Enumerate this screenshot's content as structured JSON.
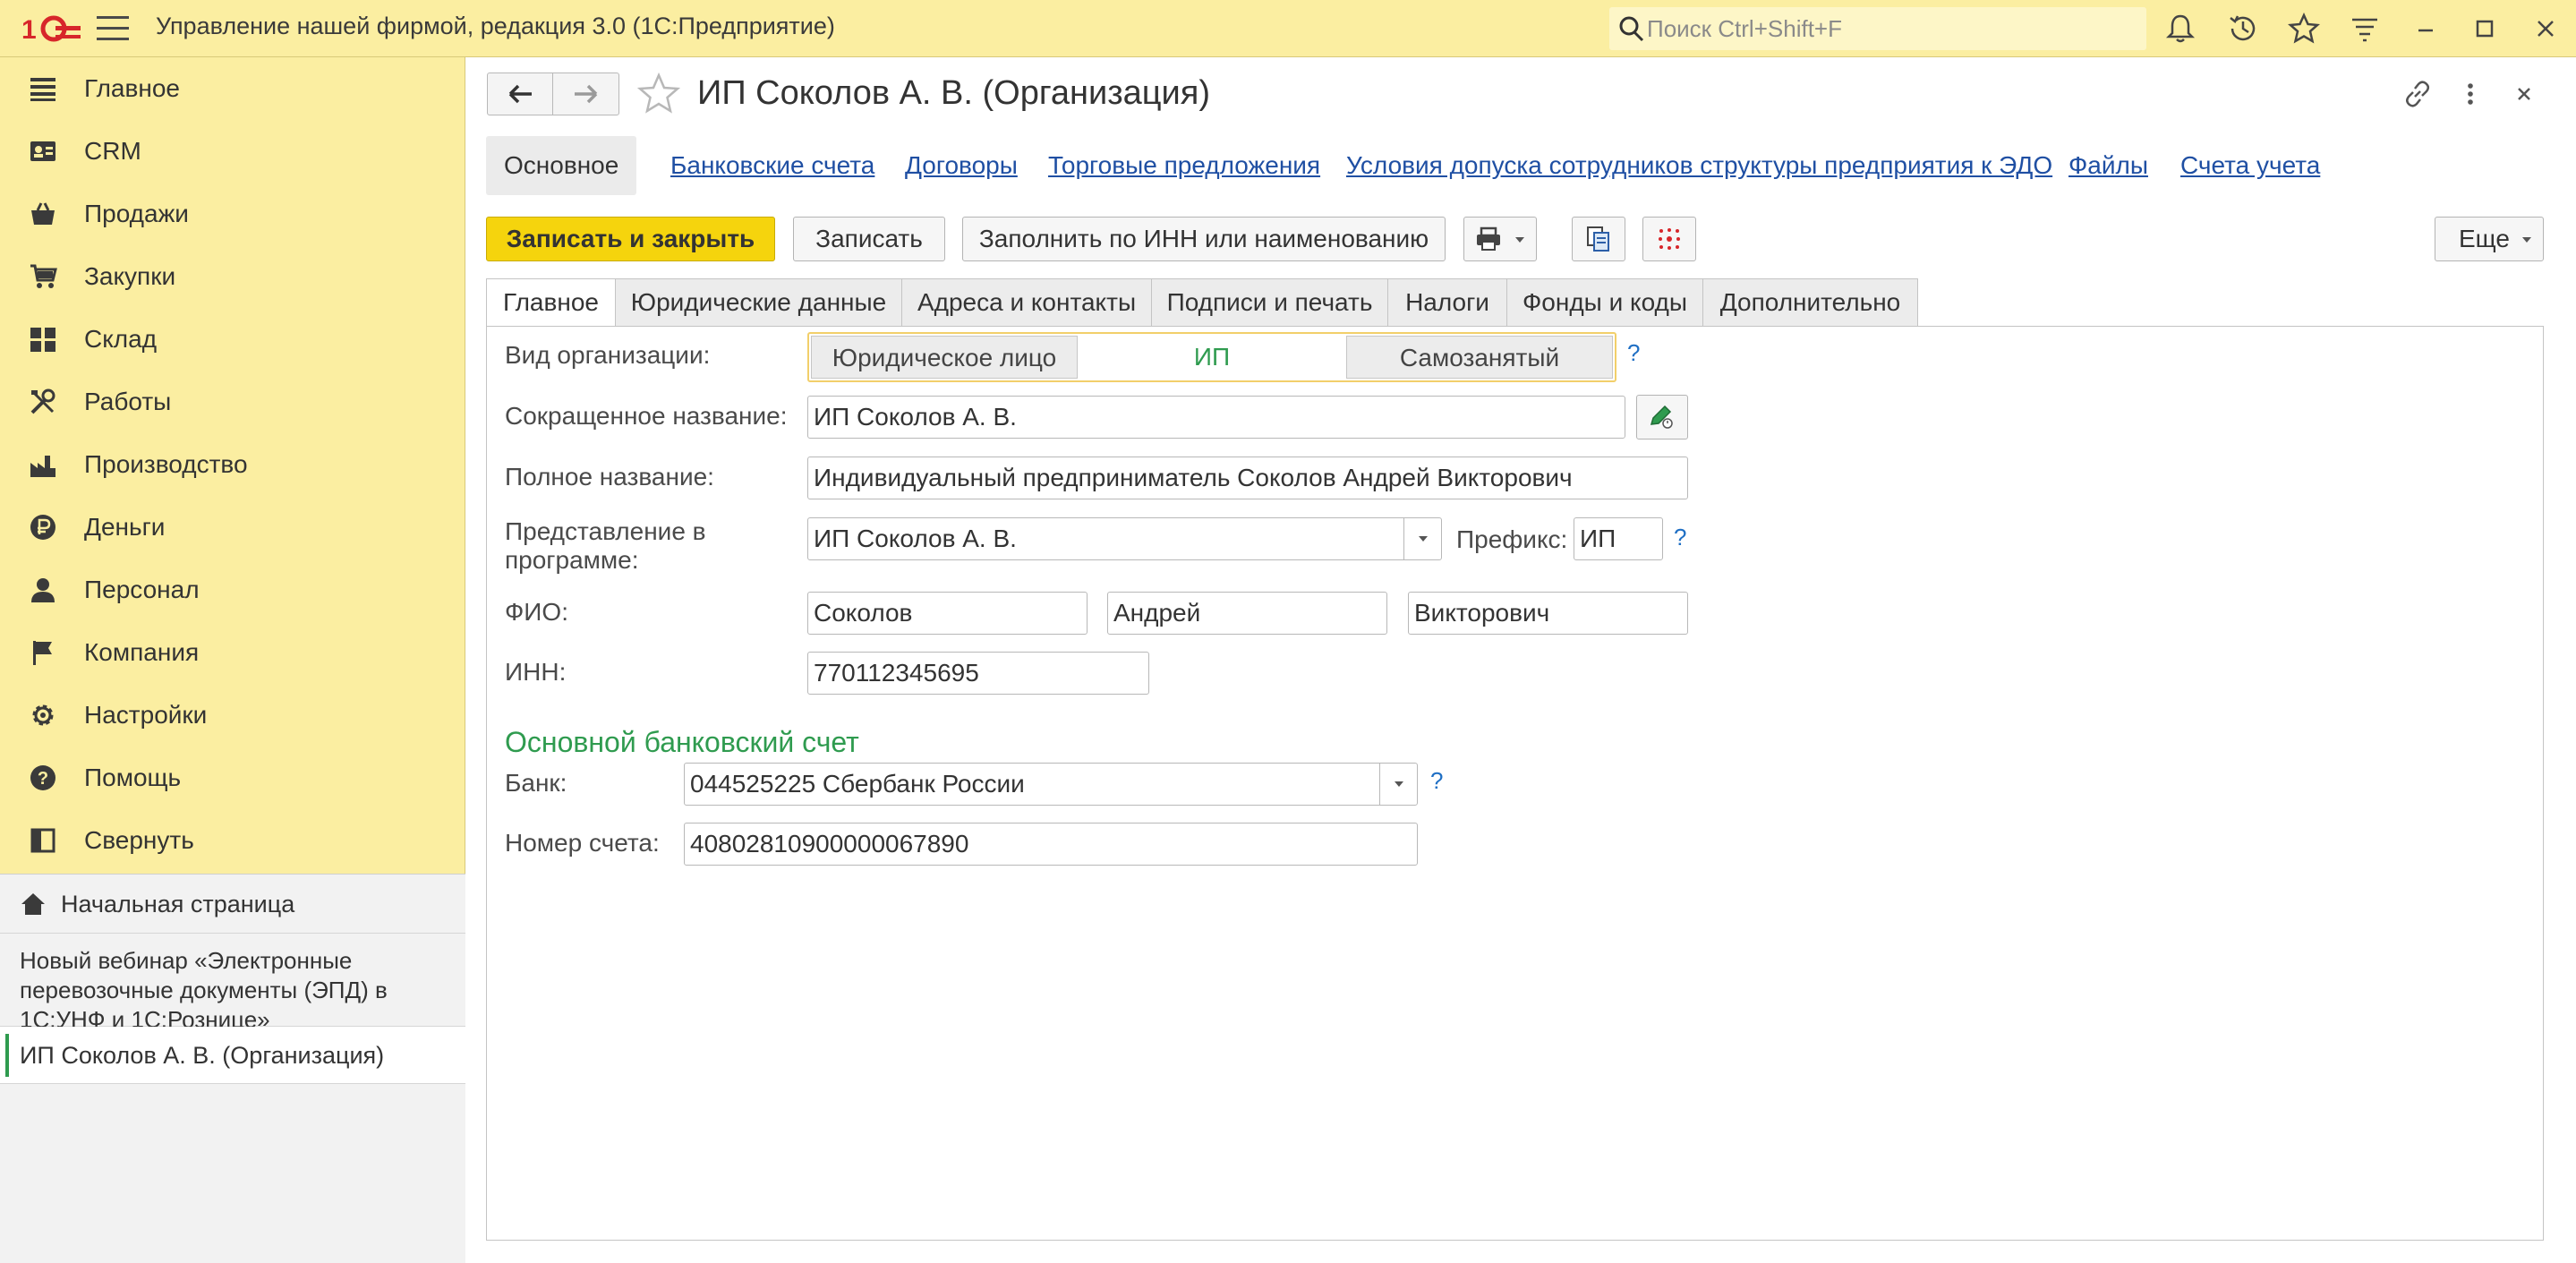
{
  "app": {
    "title": "Управление нашей фирмой, редакция 3.0  (1С:Предприятие)",
    "search_placeholder": "Поиск Ctrl+Shift+F"
  },
  "sidebar": {
    "items": [
      {
        "label": "Главное",
        "icon": "list-icon"
      },
      {
        "label": "CRM",
        "icon": "crm-icon"
      },
      {
        "label": "Продажи",
        "icon": "basket-icon"
      },
      {
        "label": "Закупки",
        "icon": "cart-icon"
      },
      {
        "label": "Склад",
        "icon": "warehouse-icon"
      },
      {
        "label": "Работы",
        "icon": "tools-icon"
      },
      {
        "label": "Производство",
        "icon": "factory-icon"
      },
      {
        "label": "Деньги",
        "icon": "ruble-icon"
      },
      {
        "label": "Персонал",
        "icon": "person-icon"
      },
      {
        "label": "Компания",
        "icon": "flag-icon"
      },
      {
        "label": "Настройки",
        "icon": "gear-icon"
      },
      {
        "label": "Помощь",
        "icon": "help-icon"
      },
      {
        "label": "Свернуть",
        "icon": "collapse-icon"
      }
    ],
    "home": "Начальная страница",
    "webinar": "Новый вебинар «Электронные перевозочные документы (ЭПД) в 1С:УНФ и 1С:Рознице»",
    "open_doc": "ИП Соколов А. В. (Организация)"
  },
  "form": {
    "title": "ИП Соколов А. В. (Организация)",
    "subnav": {
      "active": "Основное",
      "links": [
        "Банковские счета",
        "Договоры",
        "Торговые предложения",
        "Условия допуска сотрудников структуры предприятия к ЭДО",
        "Файлы",
        "Счета учета"
      ]
    },
    "toolbar": {
      "save_close": "Записать и закрыть",
      "save": "Записать",
      "fill": "Заполнить по ИНН или наименованию",
      "more": "Еще"
    },
    "tabs": [
      "Главное",
      "Юридические данные",
      "Адреса и контакты",
      "Подписи и печать",
      "Налоги",
      "Фонды и коды",
      "Дополнительно"
    ],
    "fields": {
      "org_type_label": "Вид организации:",
      "org_type_options": [
        "Юридическое лицо",
        "ИП",
        "Самозанятый"
      ],
      "org_type_selected": "ИП",
      "short_name_label": "Сокращенное название:",
      "short_name": "ИП Соколов А. В.",
      "full_name_label": "Полное название:",
      "full_name": "Индивидуальный предприниматель Соколов Андрей Викторович",
      "display_label": "Представление в программе:",
      "display_value": "ИП Соколов А. В.",
      "prefix_label": "Префикс:",
      "prefix_value": "ИП",
      "fio_label": "ФИО:",
      "last_name": "Соколов",
      "first_name": "Андрей",
      "middle_name": "Викторович",
      "inn_label": "ИНН:",
      "inn": "770112345695"
    },
    "bank": {
      "section_title": "Основной банковский счет",
      "bank_label": "Банк:",
      "bank_value": "044525225 Сбербанк России",
      "account_label": "Номер счета:",
      "account_value": "40802810900000067890"
    },
    "help_mark": "?"
  },
  "colors": {
    "accent_yellow": "#fbeea1",
    "primary_button": "#f5d40d",
    "link": "#1f4fa3",
    "green": "#2f9b4f"
  }
}
